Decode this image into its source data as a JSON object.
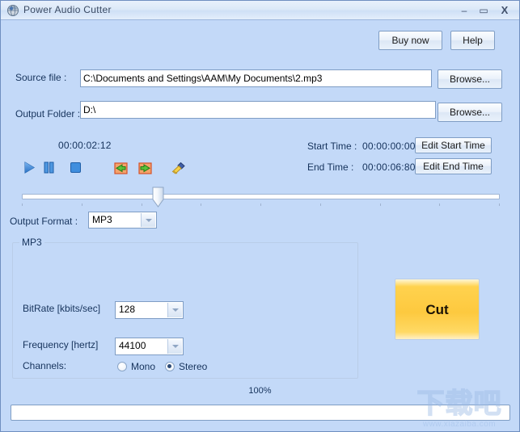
{
  "window": {
    "title": "Power Audio Cutter",
    "icon": "app-globe-icon",
    "minimize": "–",
    "maximize": "▭",
    "close": "X"
  },
  "toolbar": {
    "buy_now": "Buy now",
    "help": "Help"
  },
  "source": {
    "label": "Source file :",
    "value": "C:\\Documents and Settings\\AAM\\My Documents\\2.mp3",
    "browse": "Browse..."
  },
  "output_folder": {
    "label": "Output Folder :",
    "value": "D:\\",
    "browse": "Browse..."
  },
  "player": {
    "position": "00:00:02:12",
    "buttons": [
      {
        "name": "play-icon",
        "title": "Play"
      },
      {
        "name": "pause-icon",
        "title": "Pause"
      },
      {
        "name": "stop-icon",
        "title": "Stop"
      },
      {
        "name": "set-start-marker-icon",
        "title": "Set start"
      },
      {
        "name": "set-end-marker-icon",
        "title": "Set end"
      },
      {
        "name": "clear-broom-icon",
        "title": "Clear"
      }
    ]
  },
  "times": {
    "start_label": "Start Time :",
    "start_value": "00:00:00:00",
    "start_button": "Edit Start Time",
    "end_label": "End Time :",
    "end_value": "00:00:06:80",
    "end_button": "Edit End Time"
  },
  "slider": {
    "value_percent": 28,
    "tick_count": 9
  },
  "output_format": {
    "label": "Output Format :",
    "value": "MP3"
  },
  "mp3_group": {
    "title": "MP3",
    "bitrate_label": "BitRate [kbits/sec]",
    "bitrate_value": "128",
    "frequency_label": "Frequency [hertz]",
    "frequency_value": "44100",
    "channels_label": "Channels:",
    "mono_label": "Mono",
    "stereo_label": "Stereo",
    "channel_selected": "Stereo"
  },
  "cut": {
    "label": "Cut"
  },
  "progress": {
    "percent_text": "100%",
    "fill_percent": 0
  },
  "watermark": {
    "chinese": "下载吧",
    "url": "www.xiazaiba.com"
  },
  "colors": {
    "window_background": "#c3d9f8",
    "titlebar": "#dce9f8",
    "accent_button": "#fdc93f",
    "label_text": "#16335c",
    "control_border": "#7f9dc4"
  }
}
